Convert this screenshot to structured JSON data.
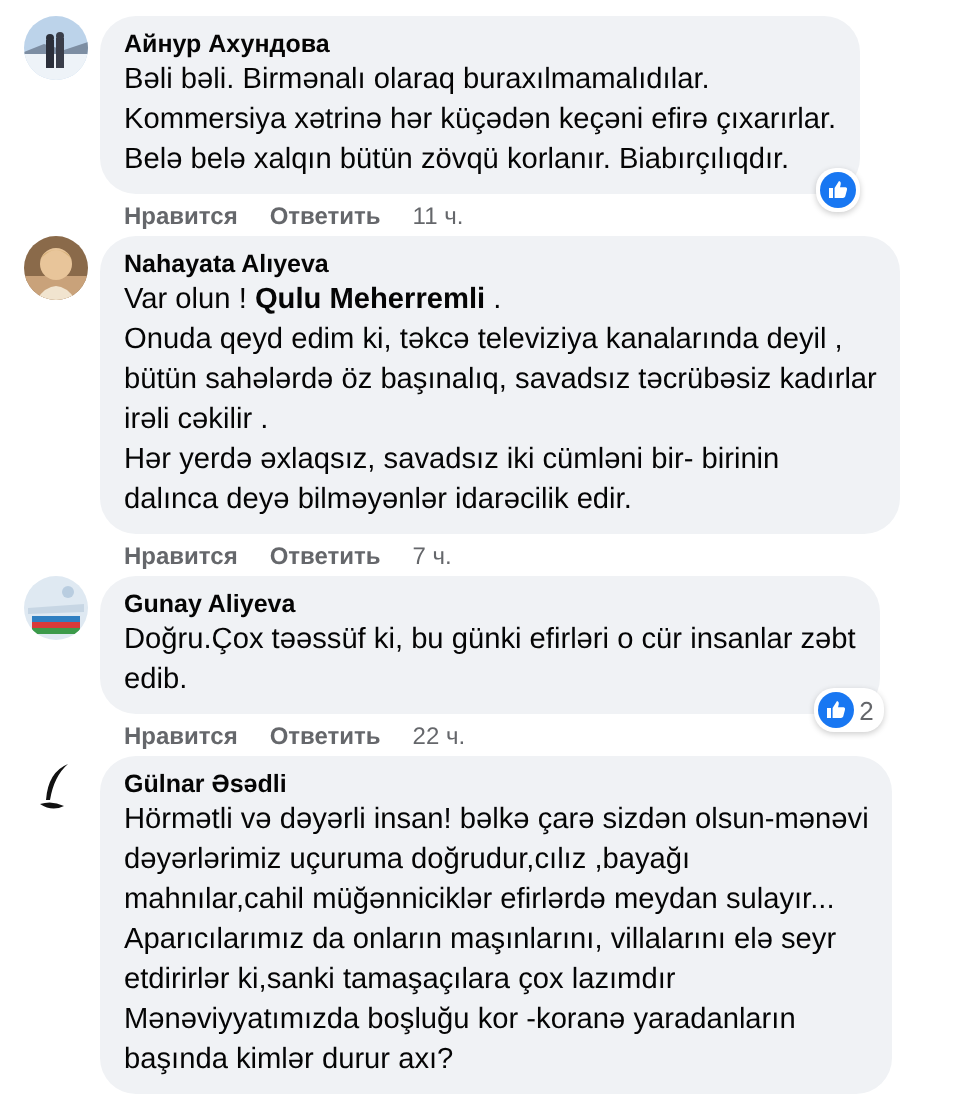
{
  "comments": [
    {
      "author": "Айнур Ахундова",
      "text": "Bəli bəli. Birmənalı olaraq buraxılmamalıdılar.\nKommersiya xətrinə hər küçədən keçəni efirə çıxarırlar.\nBelə belə xalqın bütün zövqü korlanır. Biabırçılıqdır.",
      "reaction": {
        "kind": "like"
      },
      "actions": {
        "like": "Нравится",
        "reply": "Ответить",
        "time": "11 ч."
      }
    },
    {
      "author": "Nahayata Alıyeva",
      "text": "Var olun ! **Qulu Meherremli** .\nOnuda qeyd edim ki, təkcə televiziya kanalarında deyil ,\n bütün sahələrdə öz başınalıq, savadsız təcrübəsiz kadırlar\nirəli cəkilir .\nHər yerdə əxlaqsız, savadsız iki cümləni bir- birinin\ndalınca deyə bilməyənlər idarəcilik edir.",
      "actions": {
        "like": "Нравится",
        "reply": "Ответить",
        "time": "7 ч."
      }
    },
    {
      "author": "Gunay Aliyeva",
      "text": "Doğru.Çox təəssüf ki, bu günki efirləri o cür insanlar zəbt\nedib.",
      "reaction": {
        "kind": "like",
        "count": "2"
      },
      "actions": {
        "like": "Нравится",
        "reply": "Ответить",
        "time": "22 ч."
      }
    },
    {
      "author": "Gülnar Əsədli",
      "avatar": {
        "kind": "quill"
      },
      "text": "Hörmətli və dəyərli insan! bəlkə çarə sizdən olsun-mənəvi\ndəyərlərimiz uçuruma doğrudur,cılız ,bayağı\nmahnılar,cahil müğənniciklər efirlərdə meydan sulayır...\nAparıcılarımız da onların maşınlarını, villalarını elə seyr\netdirirlər ki,sanki tamaşaçılara çox lazımdır\nMənəviyyatımızda boşluğu kor -koranə yaradanların\nbaşında kimlər durur axı?"
    }
  ]
}
